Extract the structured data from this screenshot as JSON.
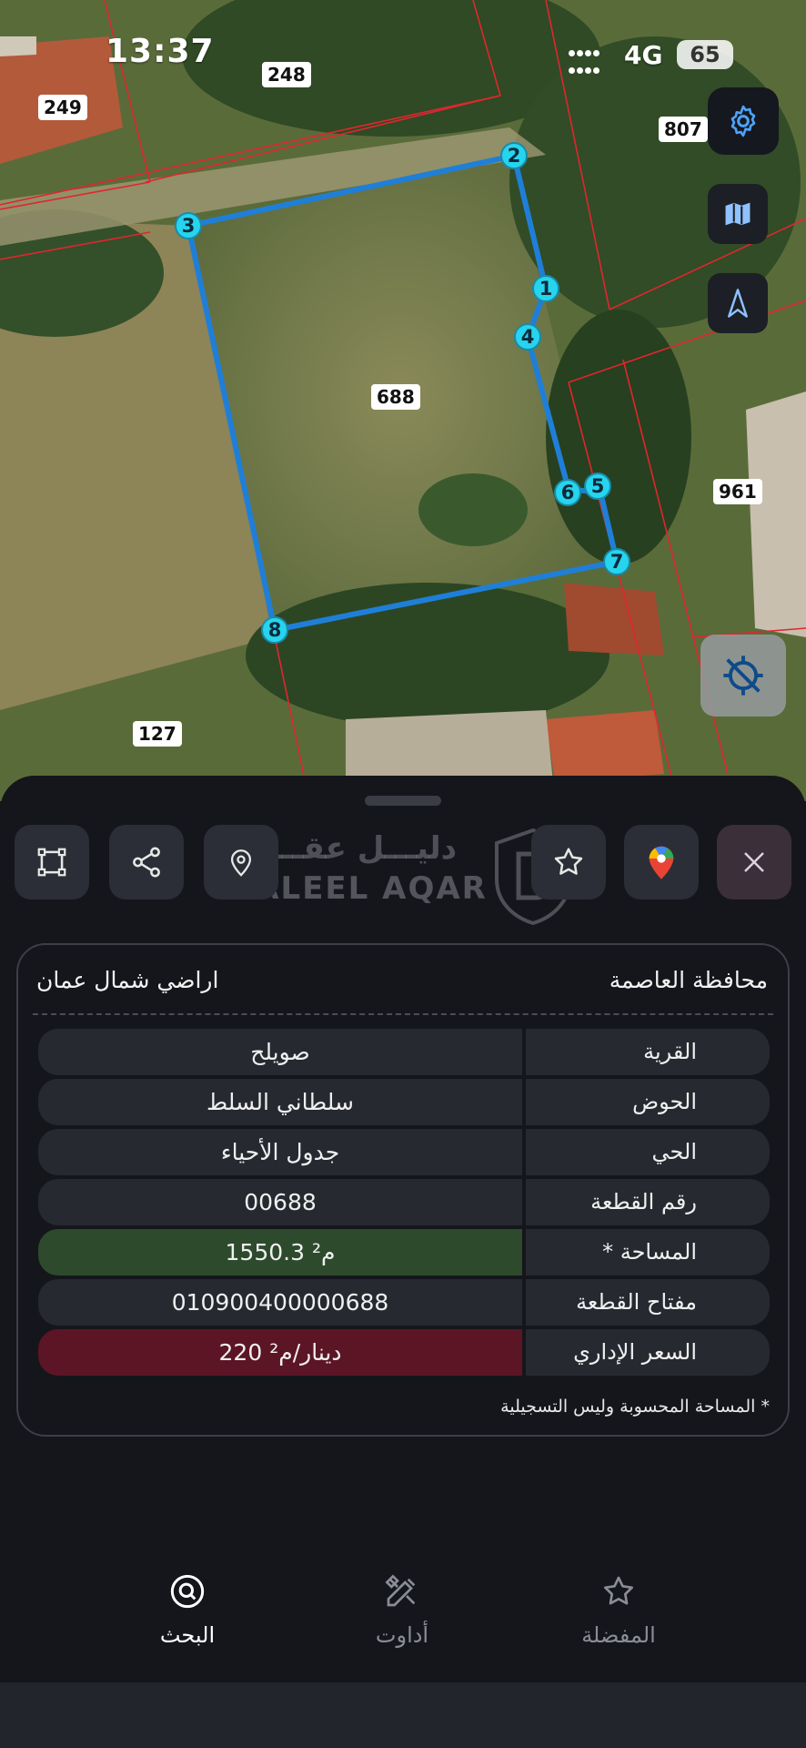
{
  "status_bar": {
    "time": "13:37",
    "network": "4G",
    "battery": "65"
  },
  "map": {
    "parcel_labels": [
      "249",
      "248",
      "807",
      "688",
      "961",
      "127"
    ],
    "vertices": [
      "1",
      "2",
      "3",
      "4",
      "5",
      "6",
      "7",
      "8"
    ],
    "controls": [
      "gear-icon",
      "map-icon",
      "north-arrow-icon",
      "locate-off-icon"
    ]
  },
  "toolbar": {
    "buttons": [
      "polygon-icon",
      "share-icon",
      "location-pin-icon",
      "star-icon",
      "google-maps-icon",
      "close-icon"
    ],
    "watermark_ar": "دليـــل عقـــار",
    "watermark_en": "DALEEL AQAR"
  },
  "info": {
    "governorate": "محافظة العاصمة",
    "region": "اراضي شمال عمان",
    "rows": [
      {
        "label": "القرية",
        "value": "صويلح"
      },
      {
        "label": "الحوض",
        "value": "سلطاني السلط"
      },
      {
        "label": "الحي",
        "value": "جدول الأحياء"
      },
      {
        "label": "رقم القطعة",
        "value": "00688"
      },
      {
        "label": "المساحة *",
        "value": "1550.3 م²"
      },
      {
        "label": "مفتاح القطعة",
        "value": "010900400000688"
      },
      {
        "label": "السعر الإداري",
        "value": "220 دينار/م²"
      }
    ],
    "footnote": "* المساحة المحسوبة وليس التسجيلية"
  },
  "nav": {
    "search": "البحث",
    "tools": "أداوت",
    "favorites": "المفضلة"
  },
  "colors": {
    "parcel_outline": "#1f7fd8",
    "vertex_fill": "#26d4ee",
    "area_bg": "#2e4a2d",
    "price_bg": "#5c1525"
  }
}
